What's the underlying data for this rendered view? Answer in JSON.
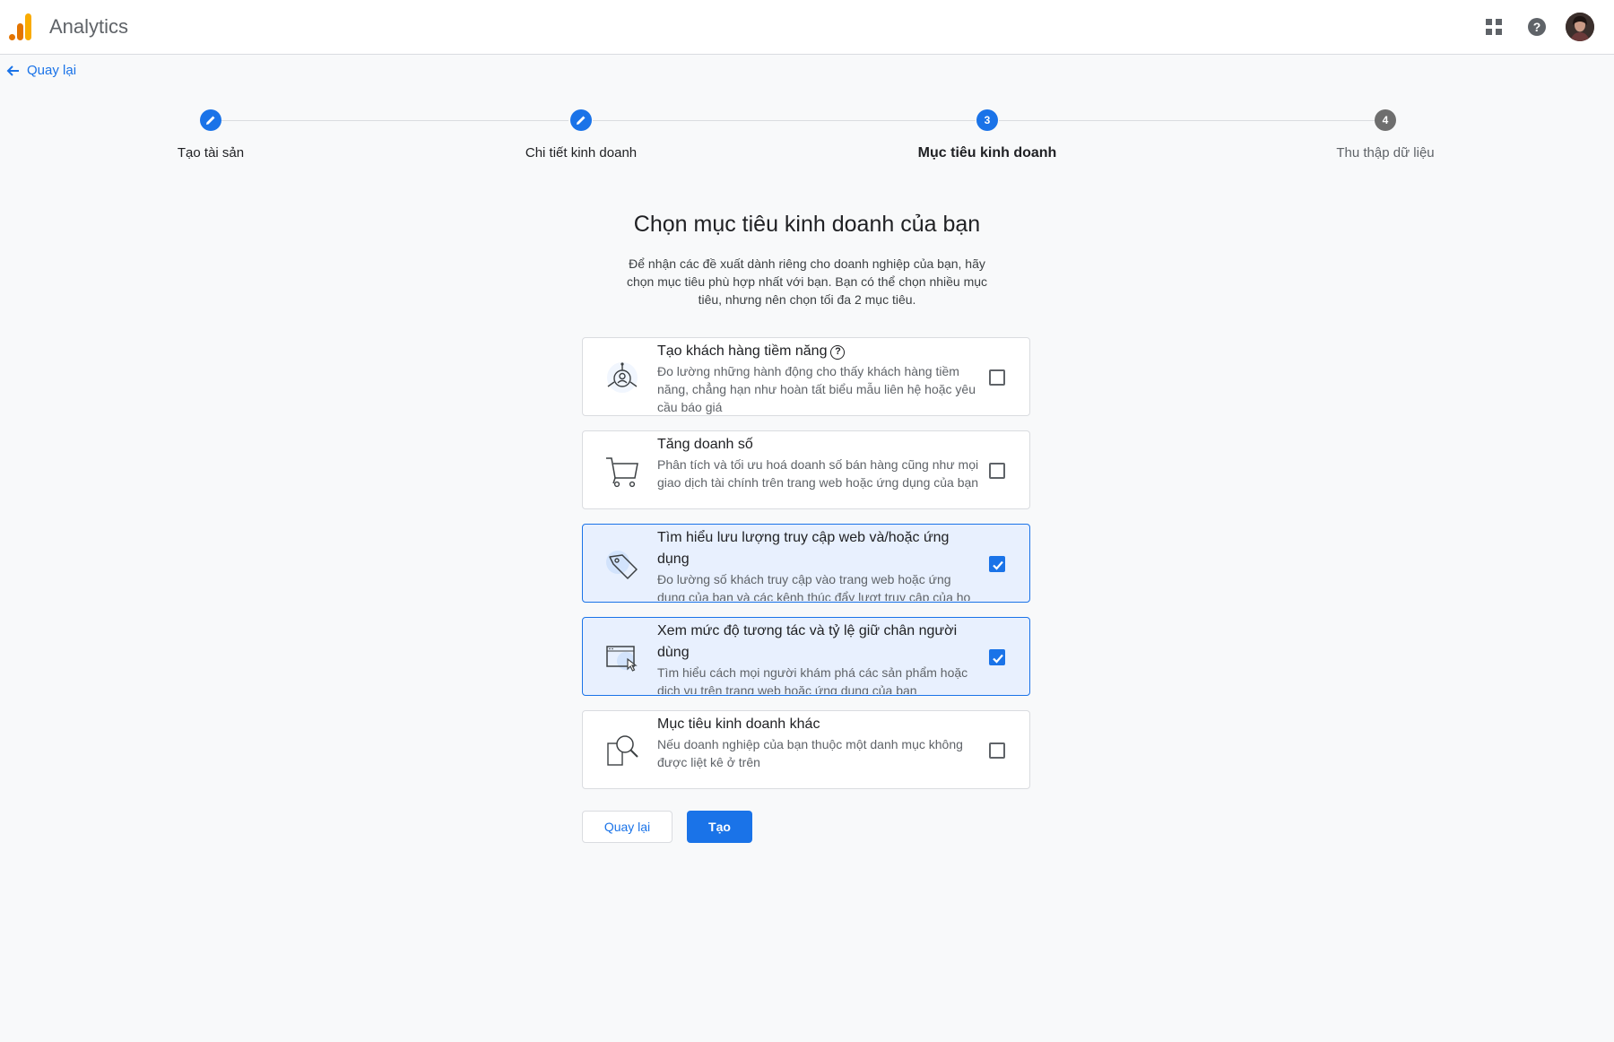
{
  "header": {
    "app_title": "Analytics",
    "icons": [
      "apps-grid-icon",
      "help-icon",
      "account-avatar"
    ],
    "logo_colors": [
      "#f9ab00",
      "#e37400"
    ]
  },
  "back_link": {
    "label": "Quay lại"
  },
  "stepper": {
    "steps": [
      {
        "label": "Tạo tài sản",
        "state": "done",
        "number": ""
      },
      {
        "label": "Chi tiết kinh doanh",
        "state": "done",
        "number": ""
      },
      {
        "label": "Mục tiêu kinh doanh",
        "state": "active",
        "number": "3"
      },
      {
        "label": "Thu thập dữ liệu",
        "state": "todo",
        "number": "4"
      }
    ]
  },
  "main": {
    "title": "Chọn mục tiêu kinh doanh của bạn",
    "description": "Để nhận các đề xuất dành riêng cho doanh nghiệp của bạn, hãy chọn mục tiêu phù hợp nhất với bạn. Bạn có thể chọn nhiều mục tiêu, nhưng nên chọn tối đa 2 mục tiêu."
  },
  "goals": [
    {
      "title": "Tạo khách hàng tiềm năng",
      "has_help_icon": true,
      "description": "Đo lường những hành động cho thấy khách hàng tiềm năng, chẳng hạn như hoàn tất biểu mẫu liên hệ hoặc yêu cầu báo giá",
      "icon": "lead-person-icon",
      "checked": false
    },
    {
      "title": "Tăng doanh số",
      "has_help_icon": false,
      "description": "Phân tích và tối ưu hoá doanh số bán hàng cũng như mọi giao dịch tài chính trên trang web hoặc ứng dụng của bạn",
      "icon": "shopping-cart-icon",
      "checked": false
    },
    {
      "title": "Tìm hiểu lưu lượng truy cập web và/hoặc ứng dụng",
      "has_help_icon": false,
      "description": "Đo lường số khách truy cập vào trang web hoặc ứng dụng của bạn và các kênh thúc đẩy lượt truy cập của họ",
      "icon": "tag-icon",
      "checked": true
    },
    {
      "title": "Xem mức độ tương tác và tỷ lệ giữ chân người dùng",
      "has_help_icon": false,
      "description": "Tìm hiểu cách mọi người khám phá các sản phẩm hoặc dịch vụ trên trang web hoặc ứng dụng của bạn",
      "icon": "browser-cursor-icon",
      "checked": true
    },
    {
      "title": "Mục tiêu kinh doanh khác",
      "has_help_icon": false,
      "description": "Nếu doanh nghiệp của bạn thuộc một danh mục không được liệt kê ở trên",
      "icon": "magnifier-icon",
      "checked": false
    }
  ],
  "actions": {
    "back_label": "Quay lại",
    "create_label": "Tạo"
  },
  "colors": {
    "accent": "#1a73e8",
    "selected_bg": "#e8f0fe",
    "step_todo": "#6e6e6e"
  }
}
